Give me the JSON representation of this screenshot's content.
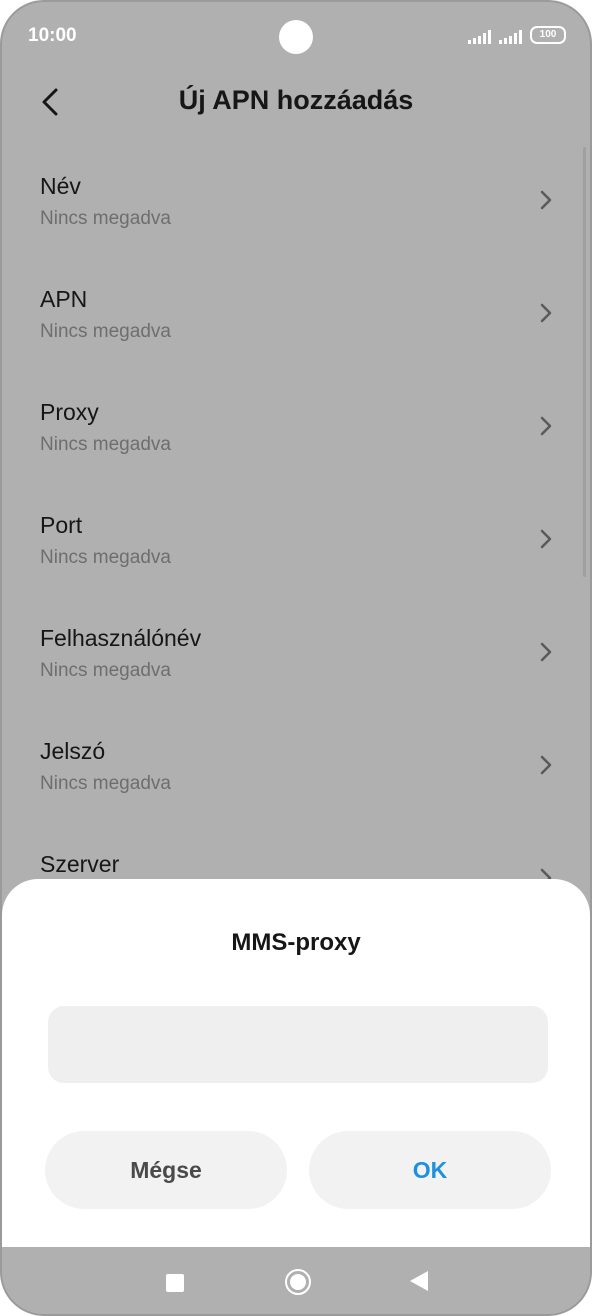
{
  "status_bar": {
    "time": "10:00",
    "battery": "100"
  },
  "header": {
    "title": "Új APN hozzáadás",
    "back_icon": "chevron-left-icon"
  },
  "list": {
    "items": [
      {
        "title": "Név",
        "subtitle": "Nincs megadva"
      },
      {
        "title": "APN",
        "subtitle": "Nincs megadva"
      },
      {
        "title": "Proxy",
        "subtitle": "Nincs megadva"
      },
      {
        "title": "Port",
        "subtitle": "Nincs megadva"
      },
      {
        "title": "Felhasználónév",
        "subtitle": "Nincs megadva"
      },
      {
        "title": "Jelszó",
        "subtitle": "Nincs megadva"
      },
      {
        "title": "Szerver",
        "subtitle": ""
      }
    ]
  },
  "dialog": {
    "title": "MMS-proxy",
    "input_value": "",
    "cancel_label": "Mégse",
    "ok_label": "OK"
  },
  "colors": {
    "accent": "#1e90e0",
    "dim_background": "#b0b0b0"
  }
}
